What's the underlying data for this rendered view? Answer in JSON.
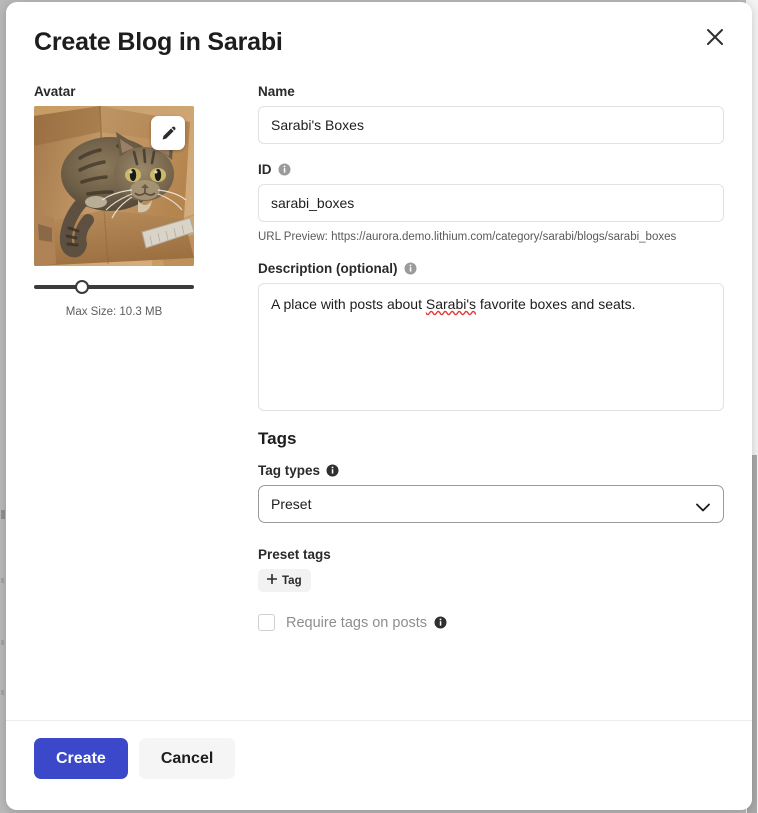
{
  "modal": {
    "title": "Create Blog in Sarabi",
    "close_icon": "close-icon"
  },
  "avatar": {
    "label": "Avatar",
    "edit_icon": "pencil-icon",
    "image_alt": "tabby cat sitting inside a cardboard box",
    "slider_value_percent": 28,
    "max_size_text": "Max Size: 10.3 MB"
  },
  "form": {
    "name": {
      "label": "Name",
      "value": "Sarabi's Boxes",
      "placeholder": ""
    },
    "id": {
      "label": "ID",
      "info_icon": "info-circle-icon",
      "value": "sarabi_boxes",
      "placeholder": "",
      "url_preview": "URL Preview: https://aurora.demo.lithium.com/category/sarabi/blogs/sarabi_boxes"
    },
    "description": {
      "label": "Description (optional)",
      "info_icon": "info-circle-icon",
      "value_before": "A place with posts about ",
      "value_misspelled": "Sarabi's",
      "value_after": " favorite boxes and seats.",
      "placeholder": ""
    }
  },
  "tags": {
    "section_title": "Tags",
    "tag_types": {
      "label": "Tag types",
      "info_icon": "info-circle-icon",
      "selected": "Preset",
      "options": [
        "Preset"
      ],
      "chevron_icon": "chevron-down-icon"
    },
    "preset_tags": {
      "label": "Preset tags",
      "add_button": "Tag",
      "add_icon": "plus-icon"
    },
    "require_tags": {
      "label": "Require tags on posts",
      "info_icon": "info-circle-icon",
      "checked": false
    }
  },
  "footer": {
    "create_label": "Create",
    "cancel_label": "Cancel"
  },
  "colors": {
    "primary": "#3b48c9",
    "secondary_bg": "#f5f5f5",
    "page_bg": "#b9b9b9",
    "border": "#e2e2e2",
    "spellcheck": "#e23b3b"
  }
}
